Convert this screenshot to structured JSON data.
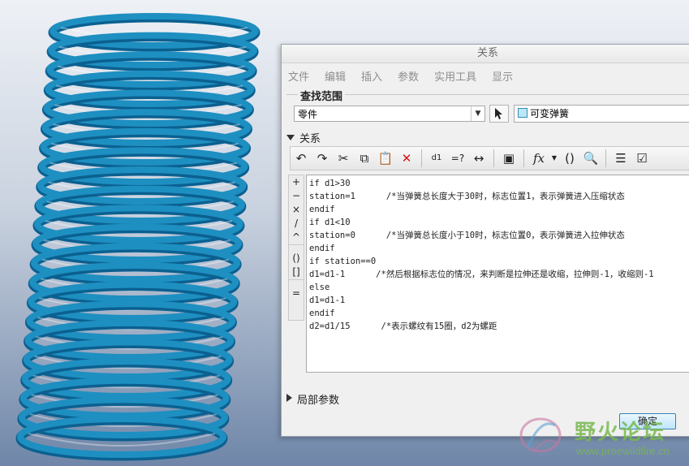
{
  "dialog": {
    "title": "关系",
    "menu": [
      "文件",
      "编辑",
      "插入",
      "参数",
      "实用工具",
      "显示"
    ],
    "scope_group": {
      "legend": "查找范围",
      "type_value": "零件",
      "part_name": "可变弹簧"
    },
    "relations_section": {
      "label": "关系"
    },
    "toolbar_icons": [
      "undo-icon",
      "redo-icon",
      "cut-icon",
      "copy-icon",
      "paste-icon",
      "delete-icon",
      "show-dim-icon",
      "evaluate-icon",
      "units-icon",
      "sort-icon",
      "function-icon",
      "brackets-icon",
      "verify-icon",
      "list-icon",
      "check-icon"
    ],
    "operators": [
      "+",
      "−",
      "×",
      "/",
      "^",
      "()",
      "[]",
      "="
    ],
    "code": [
      "if d1>30",
      "station=1      /*当弹簧总长度大于30时，标志位置1，表示弹簧进入压缩状态",
      "endif",
      "if d1<10",
      "station=0      /*当弹簧总长度小于10时，标志位置0，表示弹簧进入拉伸状态",
      "endif",
      "if station==0",
      "d1=d1-1      /*然后根据标志位的情况，来判断是拉伸还是收缩，拉伸则-1，收缩则-1",
      "else",
      "d1=d1-1",
      "endif",
      "d2=d1/15      /*表示螺纹有15圈，d2为螺距"
    ],
    "local_params_section": {
      "label": "局部参数"
    },
    "ok_button": "确定"
  },
  "watermark": {
    "cn_text": "野火论坛",
    "url": "www.proewildfire.cn"
  },
  "colors": {
    "spring": "#1e8fc1",
    "spring_dark": "#0b6090",
    "background_top": "#eef1f6",
    "background_bottom": "#6f86a8"
  }
}
